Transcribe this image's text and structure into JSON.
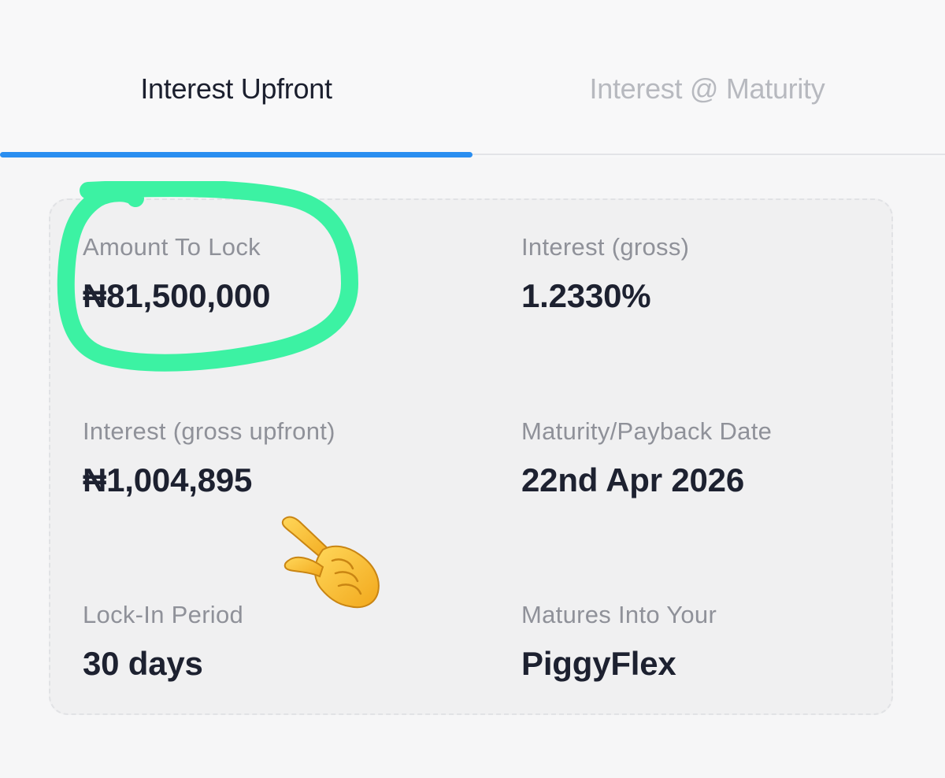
{
  "tabs": [
    {
      "label": "Interest Upfront",
      "active": true
    },
    {
      "label": "Interest @ Maturity",
      "active": false
    }
  ],
  "accent_color": "#2a8ef0",
  "highlight_color": "#3cf2a3",
  "emoji_icon": "backhand-index-pointing-right-emoji",
  "summary": {
    "amount_to_lock": {
      "label": "Amount To Lock",
      "value": "₦81,500,000"
    },
    "interest_rate": {
      "label": "Interest (gross)",
      "value": "1.2330%"
    },
    "interest_upfront": {
      "label": "Interest (gross upfront)",
      "value": "₦1,004,895"
    },
    "maturity_date": {
      "label": "Maturity/Payback Date",
      "value": "22nd Apr 2026"
    },
    "lock_in_period": {
      "label": "Lock-In Period",
      "value": "30 days"
    },
    "matures_into": {
      "label": "Matures Into Your",
      "value": "PiggyFlex"
    }
  }
}
